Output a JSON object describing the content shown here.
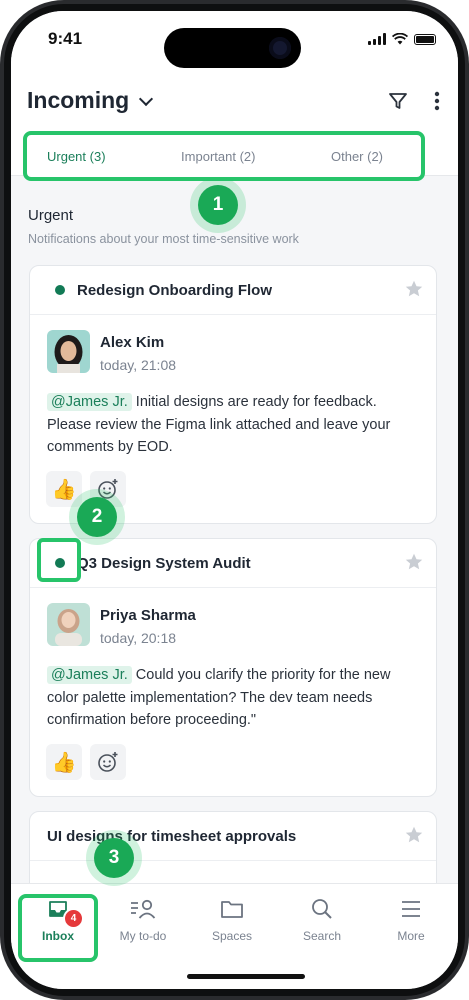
{
  "status_bar": {
    "time": "9:41"
  },
  "header": {
    "title": "Incoming"
  },
  "tabs": [
    {
      "label": "Urgent (3)",
      "active": true
    },
    {
      "label": "Important (2)",
      "active": false
    },
    {
      "label": "Other (2)",
      "active": false
    }
  ],
  "section": {
    "title": "Urgent",
    "subtitle": "Notifications about your most time-sensitive work"
  },
  "cards": [
    {
      "title": "Redesign Onboarding Flow",
      "author": "Alex Kim",
      "time": "today, 21:08",
      "mention": "@James Jr.",
      "message": "Initial designs are ready for feedback. Please review the Figma link attached and leave your comments by EOD."
    },
    {
      "title": "Q3 Design System Audit",
      "author": "Priya Sharma",
      "time": "today, 20:18",
      "mention": "@James Jr.",
      "message": "Could you clarify the priority for the new color palette implementation? The dev team needs confirmation before proceeding.\""
    },
    {
      "title": "UI designs for timesheet approvals"
    }
  ],
  "annotations": [
    "1",
    "2",
    "3"
  ],
  "bottom_nav": [
    {
      "label": "Inbox",
      "icon": "inbox-icon",
      "badge": "4",
      "active": true
    },
    {
      "label": "My to-do",
      "icon": "todo-icon",
      "active": false
    },
    {
      "label": "Spaces",
      "icon": "folder-icon",
      "active": false
    },
    {
      "label": "Search",
      "icon": "search-icon",
      "active": false
    },
    {
      "label": "More",
      "icon": "menu-icon",
      "active": false
    }
  ],
  "colors": {
    "accent": "#1b7f5a",
    "highlight": "#27c46a",
    "badge": "#e5393b"
  }
}
